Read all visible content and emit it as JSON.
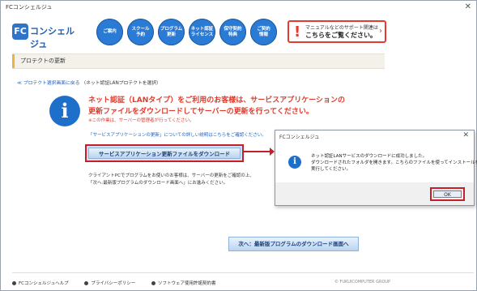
{
  "window": {
    "title": "FCコンシェルジュ",
    "close": "✕"
  },
  "header": {
    "logo_text": "コンシェルジュ",
    "logo_mark": "FC",
    "nav": [
      "ご案内",
      "スクール\n予約",
      "プログラム\n更新",
      "ネット認証\nライセンス",
      "保守契約\n特典",
      "ご契約\n情報"
    ],
    "support": {
      "line1": "マニュアルなどのサポート関連は",
      "line2": "こちらをご覧ください。",
      "arrow": "›"
    }
  },
  "section": {
    "title": "プロテクトの更新"
  },
  "breadcrumb": {
    "back_link": "≪ プロテクト選択画面に戻る",
    "current": "（ネット認証LANプロテクトを選択）"
  },
  "message": {
    "line1": "ネット認証（LANタイプ）をご利用のお客様は、サービスアプリケーションの",
    "line2": "更新ファイルをダウンロードしてサーバーの更新を行ってください。",
    "line3": "※この作業は、サーバーの管理者が行ってください。",
    "detail_link": "「サービスアプリケーションの更新」についての詳しい説明はこちらをご確認ください。"
  },
  "download_button": "サービスアプリケーション更新ファイルをダウンロード",
  "note": {
    "line1": "クライアントPCでプログラムをお使いのお客様は、サーバーの更新をご確認の上、",
    "line2": "「次へ:最新版プログラムのダウンロード画面へ」にお進みください。"
  },
  "next_button": "次へ：最新版プログラムのダウンロード画面へ",
  "footer": {
    "items": [
      "FCコンシェルジュヘルプ",
      "プライバシーポリシー",
      "ソフトウェア使用許諾契約書"
    ],
    "copyright": "© FUKUICOMPUTER GROUP"
  },
  "dialog": {
    "title": "FCコンシェルジュ",
    "close": "✕",
    "lines": [
      "ネット認証LANサービスのダウンロードに成功しました。",
      "ダウンロードされたフォルダを開きます。こちらのファイルを使ってインストールを",
      "実行してください。"
    ],
    "ok": "OK"
  },
  "colors": {
    "accent_red": "#e53a2e",
    "nav_blue": "#2a7bd6",
    "link_blue": "#1a5fbf"
  }
}
